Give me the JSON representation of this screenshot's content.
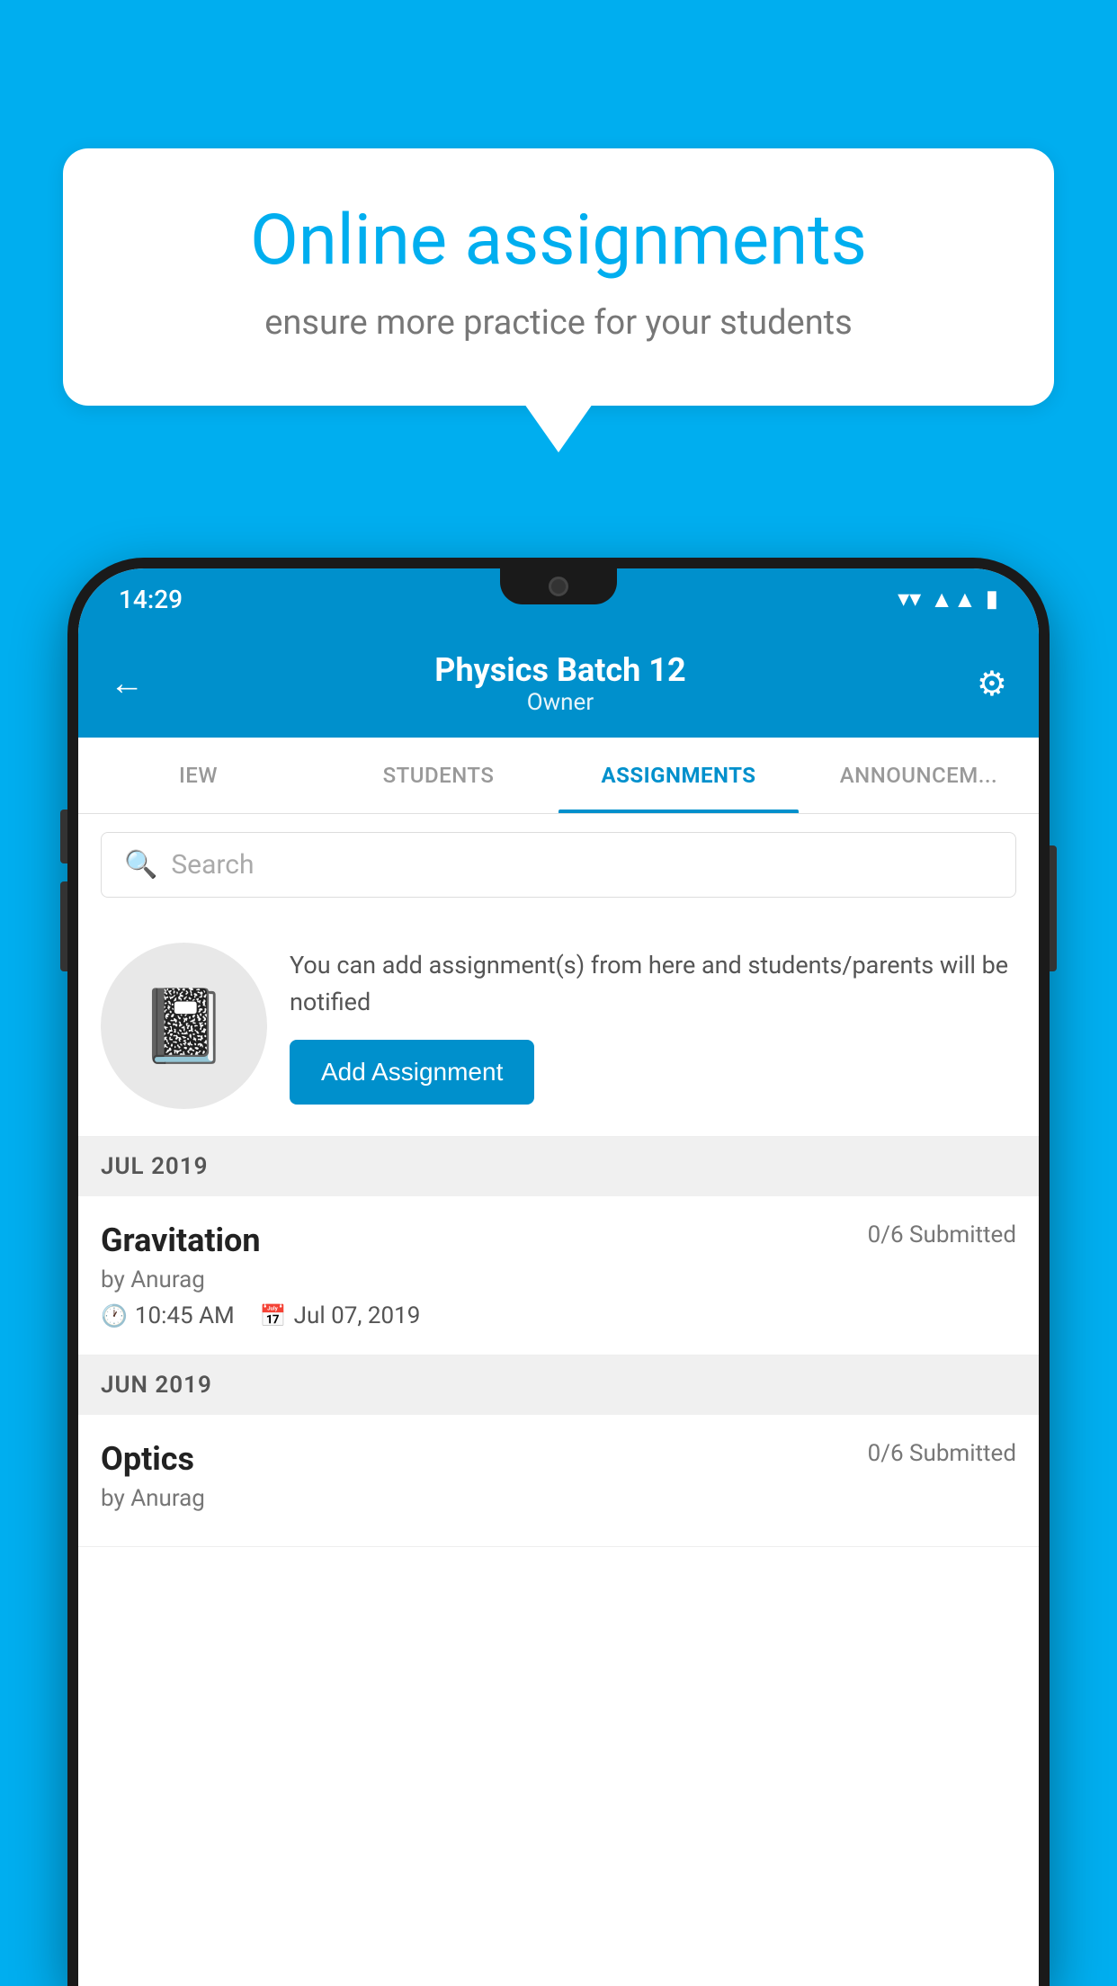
{
  "background_color": "#00AEEF",
  "speech_bubble": {
    "title": "Online assignments",
    "subtitle": "ensure more practice for your students"
  },
  "status_bar": {
    "time": "14:29",
    "wifi_icon": "▼▲",
    "signal_icon": "▲▲",
    "battery_icon": "▮"
  },
  "header": {
    "title": "Physics Batch 12",
    "subtitle": "Owner",
    "back_label": "←",
    "settings_label": "⚙"
  },
  "tabs": [
    {
      "label": "IEW",
      "active": false
    },
    {
      "label": "STUDENTS",
      "active": false
    },
    {
      "label": "ASSIGNMENTS",
      "active": true
    },
    {
      "label": "ANNOUNCEM...",
      "active": false
    }
  ],
  "search": {
    "placeholder": "Search"
  },
  "promo": {
    "text": "You can add assignment(s) from here and students/parents will be notified",
    "button_label": "Add Assignment"
  },
  "sections": [
    {
      "header": "JUL 2019",
      "assignments": [
        {
          "name": "Gravitation",
          "submitted": "0/6 Submitted",
          "author": "by Anurag",
          "time": "10:45 AM",
          "date": "Jul 07, 2019"
        }
      ]
    },
    {
      "header": "JUN 2019",
      "assignments": [
        {
          "name": "Optics",
          "submitted": "0/6 Submitted",
          "author": "by Anurag",
          "time": "",
          "date": ""
        }
      ]
    }
  ]
}
